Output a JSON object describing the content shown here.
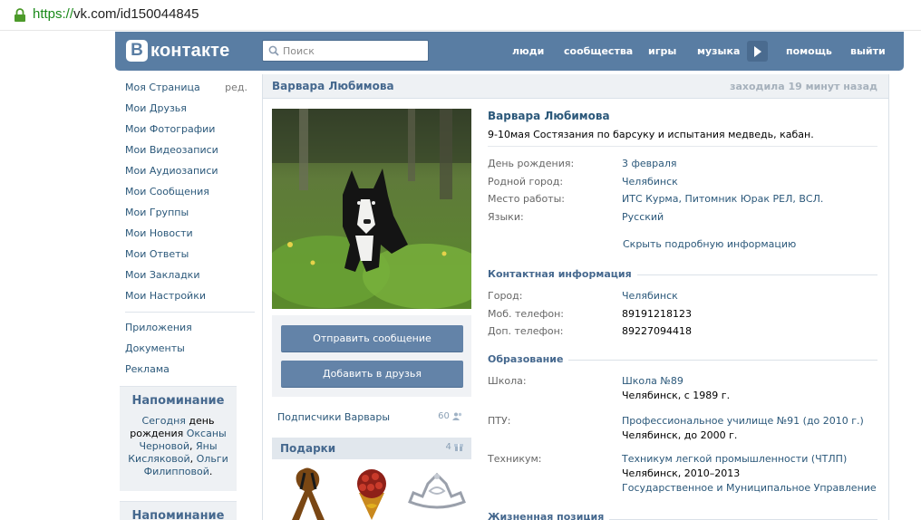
{
  "browser": {
    "url_protocol": "https://",
    "url_rest": "vk.com/id150044845"
  },
  "header": {
    "logo_letter": "B",
    "logo_word": "контакте",
    "search_placeholder": "Поиск",
    "nav": [
      "люди",
      "сообщества",
      "игры",
      "музыка",
      "помощь",
      "выйти"
    ]
  },
  "left_menu": {
    "items": [
      "Моя Страница",
      "Мои Друзья",
      "Мои Фотографии",
      "Мои Видеозаписи",
      "Мои Аудиозаписи",
      "Мои Сообщения",
      "Мои Группы",
      "Мои Новости",
      "Мои Ответы",
      "Мои Закладки",
      "Мои Настройки"
    ],
    "edit_label": "ред.",
    "extra_items": [
      "Приложения",
      "Документы",
      "Реклама"
    ]
  },
  "reminders": [
    {
      "title": "Напоминание",
      "today": "Сегодня",
      "mid": " день рождения ",
      "name1": "Оксаны Черновой",
      "sep1": ", ",
      "name2": "Яны Кисляковой",
      "sep2": ", ",
      "name3": "Ольги Филипповой",
      "end": "."
    },
    {
      "title": "Напоминание"
    }
  ],
  "page": {
    "title_name": "Варвара Любимова",
    "last_seen": "заходила 19 минут назад",
    "send_message": "Отправить сообщение",
    "add_friend": "Добавить в друзья",
    "subscribers_label": "Подписчики Варвары",
    "subscribers_count": "60",
    "gifts_label": "Подарки",
    "gifts_count": "4"
  },
  "profile": {
    "name": "Варвара Любимова",
    "status": "9-10мая Состязания по барсуку и испытания медведь, кабан.",
    "birthday_label": "День рождения:",
    "birthday": "3 февраля",
    "hometown_label": "Родной город:",
    "hometown": "Челябинск",
    "work_label": "Место работы:",
    "work": "ИТС Курма, Питомник Юрак РЕЛ, ВСЛ.",
    "languages_label": "Языки:",
    "languages": "Русский",
    "hide_details": "Скрыть подробную информацию",
    "contact_title": "Контактная информация",
    "city_label": "Город:",
    "city": "Челябинск",
    "mobile_label": "Моб. телефон:",
    "mobile": "89191218123",
    "extra_phone_label": "Доп. телефон:",
    "extra_phone": "89227094418",
    "education_title": "Образование",
    "school_label": "Школа:",
    "school": "Школа №89",
    "school_detail": "Челябинск, с 1989 г.",
    "ptu_label": "ПТУ:",
    "ptu": "Профессиональное училище №91 (до 2010 г.)",
    "ptu_detail": "Челябинск, до 2000 г.",
    "tech_label": "Техникум:",
    "tech": "Техникум легкой промышленности (ЧТЛП)",
    "tech_detail": "Челябинск, 2010–2013",
    "tech_faculty": "Государственное и Муниципальное Управление",
    "life_title": "Жизненная позиция"
  }
}
